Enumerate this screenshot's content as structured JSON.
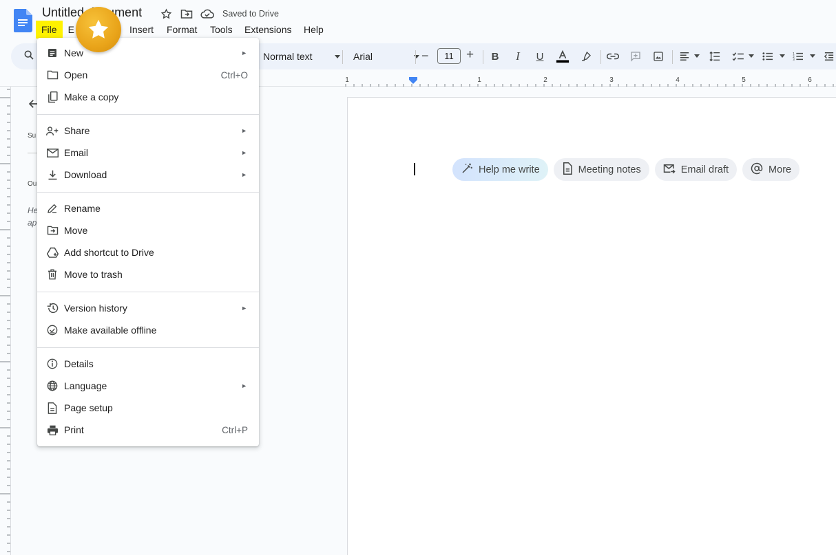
{
  "header": {
    "doc_title": "Untitled document",
    "saved_status": "Saved to Drive"
  },
  "menubar": {
    "file": "File",
    "edit": "E",
    "insert": "Insert",
    "format": "Format",
    "tools": "Tools",
    "extensions": "Extensions",
    "help": "Help"
  },
  "toolbar": {
    "paragraph_style": "Normal text",
    "font": "Arial",
    "font_size": "11",
    "minus": "−",
    "plus": "+"
  },
  "ruler": {
    "labels": [
      "1",
      "1",
      "2",
      "3",
      "4",
      "5",
      "6"
    ]
  },
  "side_panel": {
    "t1": "Su",
    "t2": "Ou",
    "t3a": "He",
    "t3b": "ap"
  },
  "chips": {
    "help_me_write": "Help me write",
    "meeting_notes": "Meeting notes",
    "email_draft": "Email draft",
    "more": "More"
  },
  "file_menu": {
    "new": "New",
    "open": "Open",
    "open_shortcut": "Ctrl+O",
    "make_copy": "Make a copy",
    "share": "Share",
    "email": "Email",
    "download": "Download",
    "rename": "Rename",
    "move": "Move",
    "add_shortcut": "Add shortcut to Drive",
    "move_to_trash": "Move to trash",
    "version_history": "Version history",
    "make_offline": "Make available offline",
    "details": "Details",
    "language": "Language",
    "page_setup": "Page setup",
    "print": "Print",
    "print_shortcut": "Ctrl+P",
    "submenu_arrow": "►"
  },
  "colors": {
    "highlight": "#fff200",
    "accent_blue": "#4285f4",
    "badge_gold": "#e9a41a"
  }
}
